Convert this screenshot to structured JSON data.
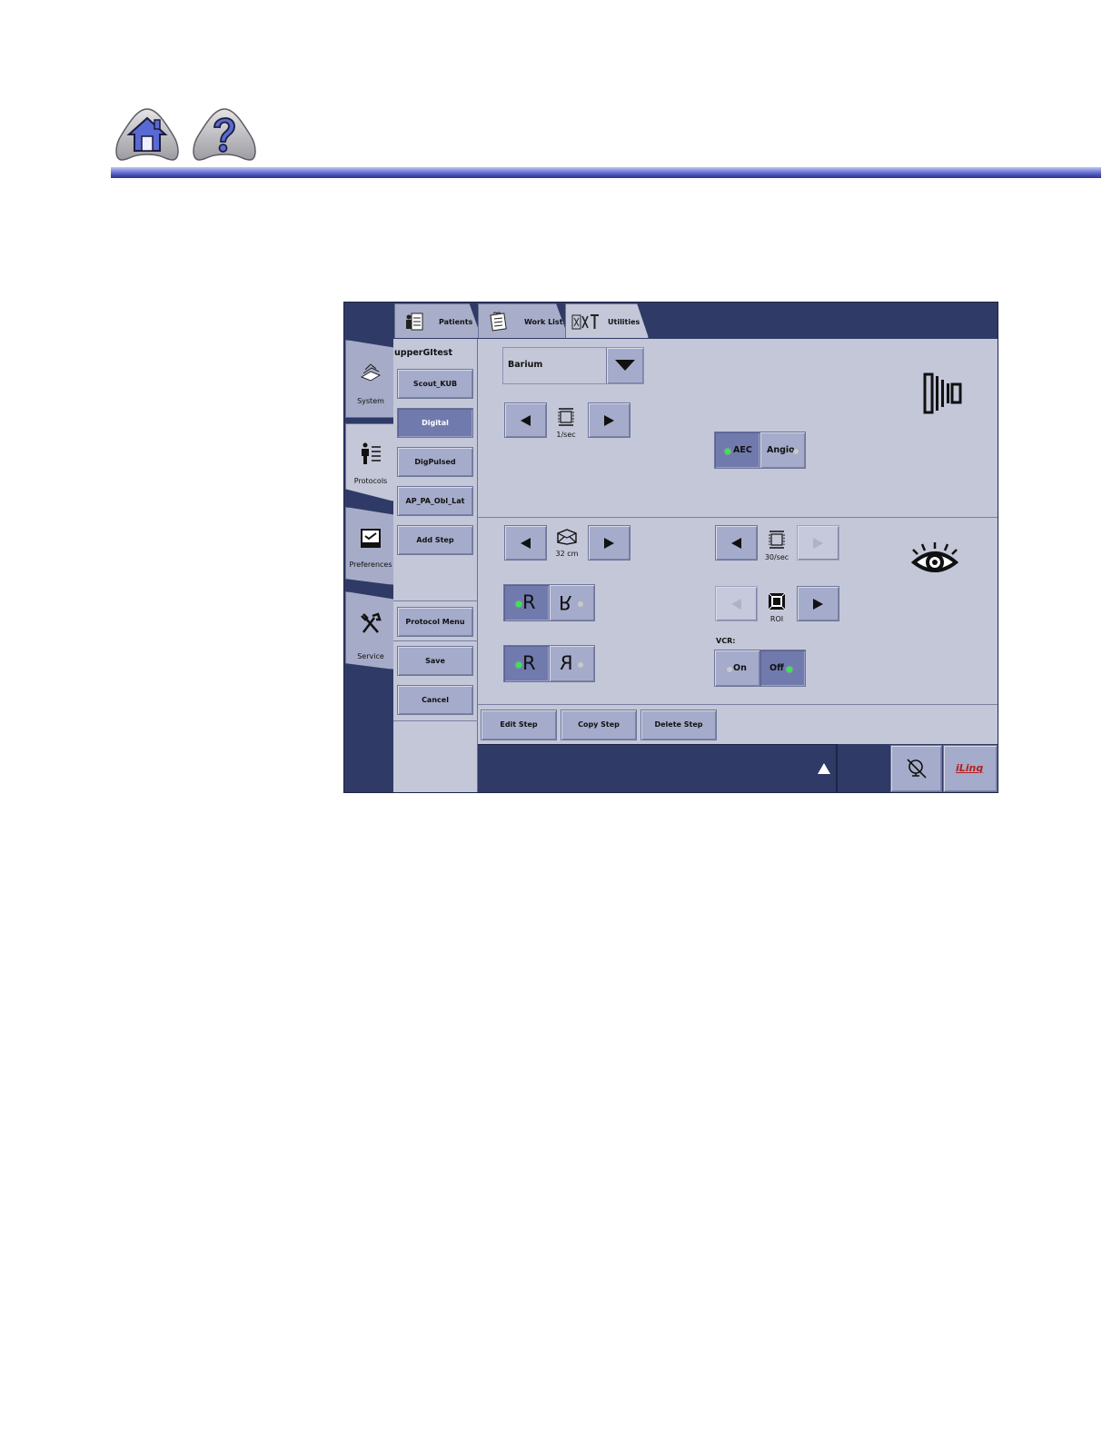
{
  "header": {
    "home_icon": "home-icon",
    "help_icon": "question-mark-icon"
  },
  "app": {
    "tabs": [
      {
        "label": "Patients",
        "icon": "patients-icon"
      },
      {
        "label": "Work List",
        "icon": "worklist-icon"
      },
      {
        "label": "Utilities",
        "icon": "utilities-icon",
        "active": true
      }
    ],
    "side_tabs": [
      {
        "label": "System",
        "icon": "system-icon"
      },
      {
        "label": "Protocols",
        "icon": "protocols-icon",
        "active": true
      },
      {
        "label": "Preferences",
        "icon": "preferences-icon"
      },
      {
        "label": "Service",
        "icon": "service-icon"
      }
    ],
    "protocol": {
      "name": "upperGItest",
      "steps": [
        "Scout_KUB",
        "Digital",
        "DigPulsed",
        "AP_PA_Obl_Lat"
      ],
      "selected_step": "Digital",
      "add_step_label": "Add Step",
      "protocol_menu_label": "Protocol Menu",
      "save_label": "Save",
      "cancel_label": "Cancel"
    },
    "acquire": {
      "contrast_value": "Barium",
      "frame_rate": "1/sec",
      "aec_label": "AEC",
      "angio_label": "Angio",
      "aec_on": true,
      "mode_icon": "exposure-acquire-icon"
    },
    "fluoro": {
      "fov": "32 cm",
      "frame_rate": "30/sec",
      "roi_label": "ROI",
      "vcr_label": "VCR:",
      "vcr_on_label": "On",
      "vcr_off_label": "Off",
      "vcr_on": false,
      "orient_lr": "R",
      "orient_lr_alt": "R",
      "orient_ud": "R",
      "orient_ud_alt": "R",
      "mode_icon": "eye-icon"
    },
    "step_actions": {
      "edit_label": "Edit Step",
      "copy_label": "Copy Step",
      "delete_label": "Delete Step"
    },
    "status_bar": {
      "expand_icon": "triangle-up-icon",
      "no_signal_icon": "no-display-icon",
      "iling_label": "iLinq"
    },
    "colors": {
      "frame": "#2f3a66",
      "panel": "#c3c7d8",
      "button": "#a5abca",
      "button_selected": "#717aac",
      "led_active": "#38e84a"
    }
  }
}
